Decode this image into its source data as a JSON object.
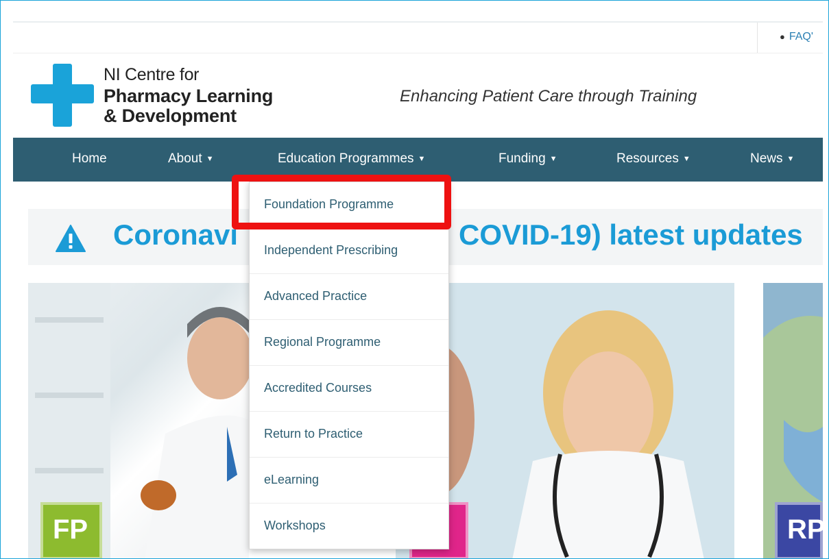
{
  "topbar": {
    "faq_label": "FAQ'"
  },
  "logo": {
    "line1": "NI Centre for",
    "line2": "Pharmacy Learning",
    "line3": "& Development",
    "cross_color": "#1aa3d9"
  },
  "tagline": "Enhancing Patient Care through Training",
  "nav": {
    "items": [
      {
        "label": "Home",
        "caret": ""
      },
      {
        "label": "About",
        "caret": "▼"
      },
      {
        "label": "Education Programmes",
        "caret": "▼"
      },
      {
        "label": "Funding",
        "caret": "▼"
      },
      {
        "label": "Resources",
        "caret": "▼"
      },
      {
        "label": "News",
        "caret": "▼"
      }
    ],
    "background": "#2e5e72"
  },
  "alert": {
    "text_left": "Coronavi",
    "text_right": "COVID-19) latest updates"
  },
  "dropdown": {
    "items": [
      "Foundation Programme",
      "Independent Prescribing",
      "Advanced Practice",
      "Regional Programme",
      "Accredited Courses",
      "Return to Practice",
      "eLearning",
      "Workshops"
    ],
    "highlighted_index": 0,
    "highlight_color": "#ee1111"
  },
  "badges": {
    "fp": "FP",
    "mid": "",
    "rp": "RP"
  }
}
